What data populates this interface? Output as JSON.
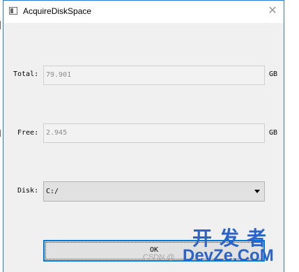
{
  "window": {
    "title": "AcquireDiskSpace",
    "close_glyph": "✕"
  },
  "form": {
    "total": {
      "label": "Total:",
      "value": "79.901",
      "unit": "GB"
    },
    "free": {
      "label": "Free:",
      "value": "2.945",
      "unit": "GB"
    },
    "disk": {
      "label": "Disk:",
      "selected": "C:/"
    },
    "ok_label": "OK"
  },
  "watermark": {
    "left_text": "CSDN @",
    "cn_text": "开发者",
    "en_text": "DevZe.CoM"
  },
  "icons": {
    "app": "window-icon",
    "close": "close-icon",
    "dropdown": "chevron-down-icon"
  },
  "colors": {
    "window_border": "#2b7ad6",
    "focus_border": "#0078d7",
    "watermark": "#2a64c8"
  }
}
